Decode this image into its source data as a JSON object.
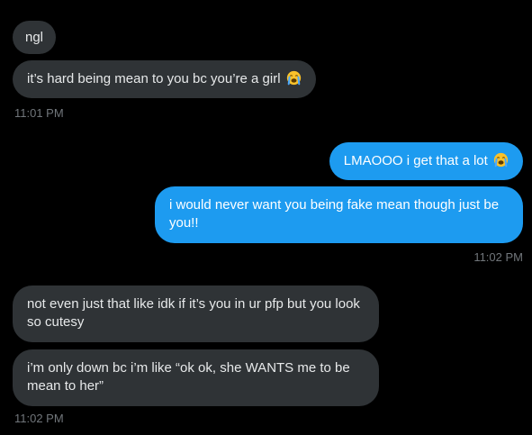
{
  "conversation": {
    "group1": {
      "messages": [
        {
          "text": "ngl"
        },
        {
          "text": "it’s hard being mean to you bc you’re a girl",
          "emoji": "loudly-crying-face-icon"
        }
      ],
      "timestamp": "11:01 PM"
    },
    "group2": {
      "messages": [
        {
          "text": "LMAOOO i get that a lot",
          "emoji": "loudly-crying-face-icon"
        },
        {
          "text": "i would never want you being fake mean though just be you!!"
        }
      ],
      "timestamp": "11:02 PM"
    },
    "group3": {
      "messages": [
        {
          "text": "not even just that like idk if it’s you in ur pfp but you look so cutesy"
        },
        {
          "text": "i’m only down bc i’m like “ok ok, she WANTS me to be mean to her”"
        }
      ],
      "timestamp": "11:02 PM"
    }
  },
  "colors": {
    "background": "#000000",
    "received_bubble": "#2f3336",
    "sent_bubble": "#1d9bf0",
    "timestamp": "#71767b"
  }
}
